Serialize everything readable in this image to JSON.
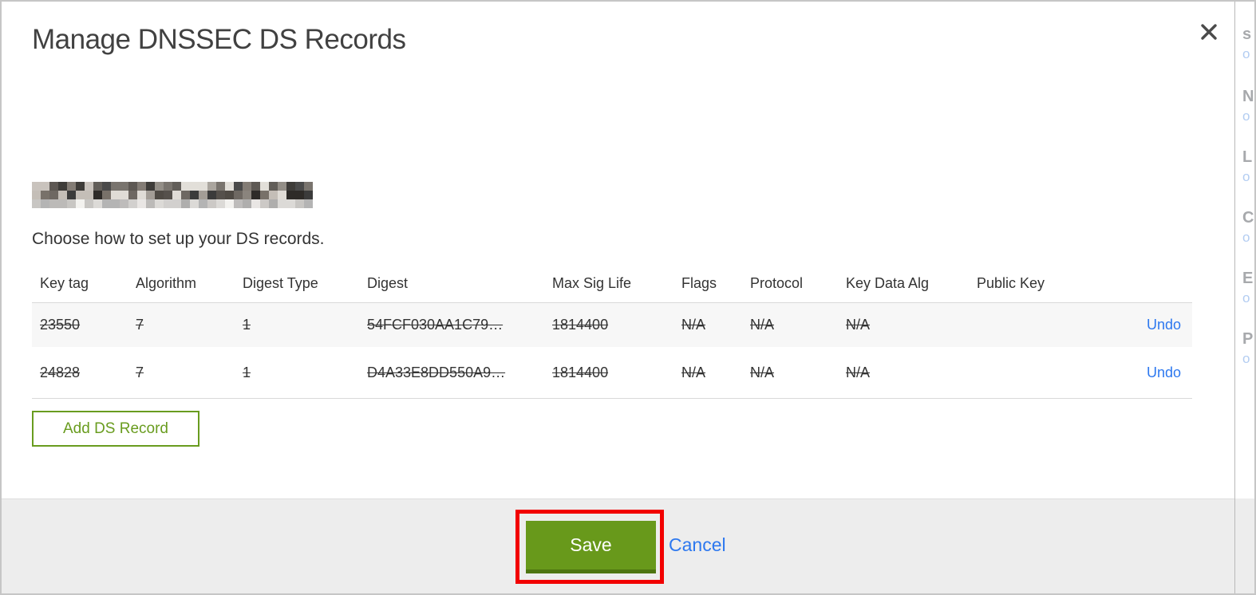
{
  "modal": {
    "title": "Manage DNSSEC DS Records",
    "subtitle": "Choose how to set up your DS records.",
    "domain_redacted": true,
    "domain_mosaic": {
      "palette": [
        "#3b3b3b",
        "#55504b",
        "#6e6862",
        "#8a847d",
        "#a39d96",
        "#c4beb7",
        "#2e2b28",
        "#787169",
        "#e0dcd6",
        "#4f4a44"
      ]
    },
    "table": {
      "headers": [
        "Key tag",
        "Algorithm",
        "Digest Type",
        "Digest",
        "Max Sig Life",
        "Flags",
        "Protocol",
        "Key Data Alg",
        "Public Key"
      ],
      "rows": [
        {
          "key_tag": "23550",
          "algorithm": "7",
          "digest_type": "1",
          "digest": "54FCF030AA1C79…",
          "max_sig_life": "1814400",
          "flags": "N/A",
          "protocol": "N/A",
          "key_data_alg": "N/A",
          "public_key": "",
          "action": "Undo",
          "deleted": true
        },
        {
          "key_tag": "24828",
          "algorithm": "7",
          "digest_type": "1",
          "digest": "D4A33E8DD550A9…",
          "max_sig_life": "1814400",
          "flags": "N/A",
          "protocol": "N/A",
          "key_data_alg": "N/A",
          "public_key": "",
          "action": "Undo",
          "deleted": true
        }
      ]
    },
    "add_button_label": "Add DS Record",
    "footer": {
      "save_label": "Save",
      "cancel_label": "Cancel"
    }
  },
  "colors": {
    "accent_green": "#68991b",
    "accent_green_dark": "#4e7511",
    "outline_green": "#699c1f",
    "link_blue": "#2d78ef",
    "annotation_red": "#f20000",
    "footer_gray": "#ededed",
    "row_gray": "#f7f7f7"
  },
  "background_strip": {
    "labels": [
      "s",
      "N",
      "L",
      "C",
      "E",
      "P"
    ],
    "links": [
      "o",
      "o",
      "o",
      "o",
      "o",
      "o"
    ]
  }
}
